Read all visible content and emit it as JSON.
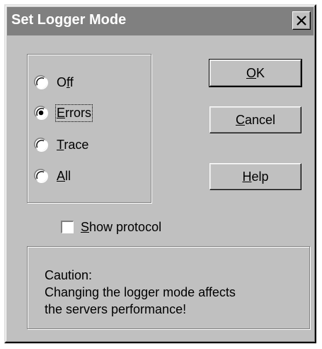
{
  "window": {
    "title": "Set Logger Mode",
    "close_label": "Close"
  },
  "mode_group": {
    "options": [
      {
        "label": "Off",
        "mnemonic_index": 1,
        "selected": false,
        "focused": false
      },
      {
        "label": "Errors",
        "mnemonic_index": 0,
        "selected": true,
        "focused": true
      },
      {
        "label": "Trace",
        "mnemonic_index": 0,
        "selected": false,
        "focused": false
      },
      {
        "label": "All",
        "mnemonic_index": 0,
        "selected": false,
        "focused": false
      }
    ]
  },
  "buttons": {
    "ok": "OK",
    "cancel": "Cancel",
    "help": "Help"
  },
  "show_protocol": {
    "label": "Show protocol",
    "checked": false
  },
  "caution": {
    "line1": "Caution:",
    "line2": "Changing the logger mode affects",
    "line3": "the servers performance!"
  },
  "colors": {
    "face": "#c0c0c0",
    "titlebar": "#808080",
    "title_text": "#ffffff"
  },
  "icons": {
    "close": "close-x-icon",
    "radio": "radio-button-icon",
    "checkbox": "checkbox-icon"
  }
}
